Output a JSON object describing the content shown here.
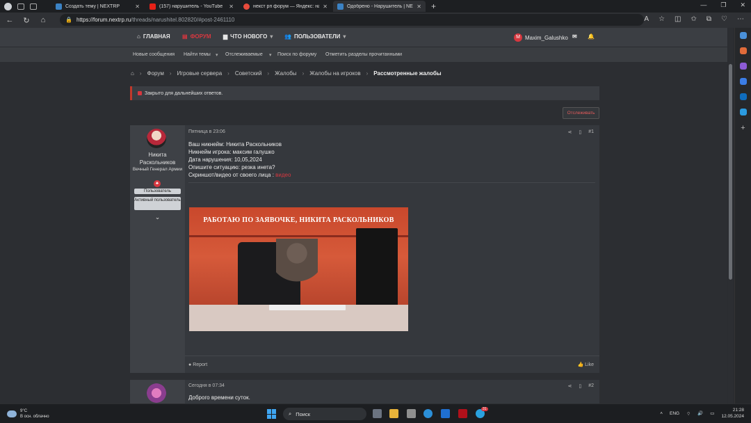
{
  "browser": {
    "tabs": [
      {
        "title": "Создать тему | NEXTRP",
        "color": "#3b82c4",
        "active": false
      },
      {
        "title": "(157) нарушитель - YouTube",
        "color": "#e62117",
        "active": false
      },
      {
        "title": "некст рп форум — Яндекс: наш",
        "color": "#e84b3c",
        "active": false
      },
      {
        "title": "Одобрено - Нарушитель | NEXT",
        "color": "#3b82c4",
        "active": true
      }
    ],
    "url_domain": "https://forum.nextrp.ru",
    "url_path": "/threads/narushitel.802820/#post-2461110"
  },
  "forum": {
    "nav": {
      "home": "ГЛАВНАЯ",
      "forum": "ФОРУМ",
      "whats_new": "ЧТО НОВОГО",
      "users": "ПОЛЬЗОВАТЕЛИ",
      "username": "Maxim_Galushko",
      "avatar_letter": "M"
    },
    "subnav": [
      "Новые сообщения",
      "Найти темы",
      "Отслеживаемые",
      "Поиск по форуму",
      "Отметить разделы прочитанными"
    ],
    "breadcrumbs": [
      "Форум",
      "Игровые сервера",
      "Советский",
      "Жалобы",
      "Жалобы на игроков"
    ],
    "breadcrumb_current": "Рассмотренные жалобы",
    "notice": "Закрыто для дальнейших ответов.",
    "watch_button": "Отслеживать"
  },
  "post1": {
    "author": "Никита Раскольников",
    "author_title": "Вечный Генерал Армии",
    "banners": [
      "Пользователь",
      "Активный пользователь"
    ],
    "date": "Пятница в 23:06",
    "number": "#1",
    "lines": [
      "Ваш никнейм: Никита Раскольников",
      "Никнейм игрока: максим галушко",
      "Дата нарушения: 10,05,2024",
      "Опишите ситуацию: резка инета?"
    ],
    "evidence_label": "Скриншот/видео от своего лица : ",
    "evidence_link": "видео",
    "gif_caption": "РАБОТАЮ ПО ЗАЯВОЧКЕ, НИКИТА РАСКОЛЬНИКОВ",
    "report": "Report",
    "like": "Like"
  },
  "post2": {
    "date": "Сегодня в 07:34",
    "number": "#2",
    "text": "Доброго времени суток."
  },
  "taskbar": {
    "temp": "9°C",
    "weather": "В осн. облачно",
    "search": "Поиск",
    "lang": "ENG",
    "time": "21:28",
    "date": "12.05.2024",
    "badge": "31"
  },
  "colors": {
    "accent": "#d7373f",
    "bg": "#2c2e32",
    "panel": "#35383d"
  }
}
